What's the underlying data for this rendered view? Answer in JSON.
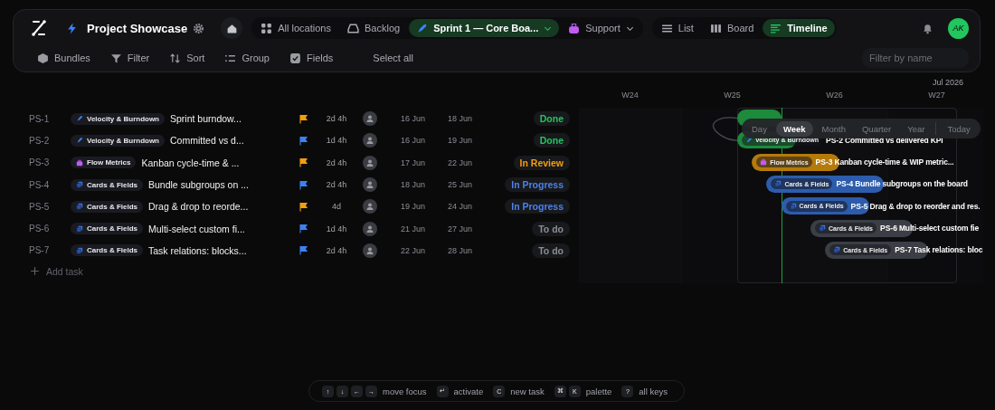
{
  "project": {
    "title": "Project Showcase"
  },
  "nav": [
    {
      "label": "All locations",
      "selected": false,
      "dropdown": false
    },
    {
      "label": "Backlog",
      "selected": false,
      "dropdown": false
    },
    {
      "label": "Sprint 1 — Core Boa...",
      "selected": true,
      "dropdown": true
    },
    {
      "label": "Support",
      "selected": false,
      "dropdown": true
    }
  ],
  "views": [
    {
      "label": "List",
      "selected": false
    },
    {
      "label": "Board",
      "selected": false
    },
    {
      "label": "Timeline",
      "selected": true
    }
  ],
  "user": {
    "initials": "AK"
  },
  "toolbar": [
    "Bundles",
    "Filter",
    "Sort",
    "Group",
    "Fields"
  ],
  "select_all": "Select all",
  "search": {
    "placeholder": "Filter by name"
  },
  "timeline": {
    "month": "Jul 2026",
    "weeks": [
      "W24",
      "W25",
      "W26",
      "W27"
    ],
    "scales": [
      {
        "label": "Day",
        "selected": false
      },
      {
        "label": "Week",
        "selected": true
      },
      {
        "label": "Month",
        "selected": false
      },
      {
        "label": "Quarter",
        "selected": false
      },
      {
        "label": "Year",
        "selected": false
      }
    ],
    "today_button": "Today"
  },
  "tasks": [
    {
      "id": "PS-1",
      "bundle": {
        "label": "Velocity & Burndown",
        "kind": "velocity"
      },
      "title": "Sprint burndow...",
      "flag": {
        "color": "#f59e0b"
      },
      "estimate": "2d 4h",
      "start": "16 Jun",
      "end": "18 Jun",
      "status": {
        "label": "Done",
        "kind": "done"
      }
    },
    {
      "id": "PS-2",
      "bundle": {
        "label": "Velocity & Burndown",
        "kind": "velocity"
      },
      "title": "Committed vs d...",
      "flag": {
        "color": "#3b82f6"
      },
      "estimate": "1d 4h",
      "start": "16 Jun",
      "end": "19 Jun",
      "status": {
        "label": "Done",
        "kind": "done"
      },
      "bar": {
        "bundle": "Velocity & Burndown",
        "id": "PS-2",
        "title": "Committed vs delivered KPI"
      }
    },
    {
      "id": "PS-3",
      "bundle": {
        "label": "Flow Metrics",
        "kind": "flow"
      },
      "title": "Kanban cycle-time & ...",
      "flag": {
        "color": "#f59e0b"
      },
      "estimate": "2d 4h",
      "start": "17 Jun",
      "end": "22 Jun",
      "status": {
        "label": "In Review",
        "kind": "review"
      },
      "bar": {
        "bundle": "Flow Metrics",
        "id": "PS-3",
        "title": "Kanban cycle-time & WIP metric..."
      }
    },
    {
      "id": "PS-4",
      "bundle": {
        "label": "Cards & Fields",
        "kind": "cards"
      },
      "title": "Bundle subgroups on ...",
      "flag": {
        "color": "#3b82f6"
      },
      "estimate": "2d 4h",
      "start": "18 Jun",
      "end": "25 Jun",
      "status": {
        "label": "In Progress",
        "kind": "progress"
      },
      "bar": {
        "bundle": "Cards & Fields",
        "id": "PS-4",
        "title": "Bundle subgroups on the board"
      }
    },
    {
      "id": "PS-5",
      "bundle": {
        "label": "Cards & Fields",
        "kind": "cards"
      },
      "title": "Drag & drop to reorde...",
      "flag": {
        "color": "#f59e0b"
      },
      "estimate": "4d",
      "start": "19 Jun",
      "end": "24 Jun",
      "status": {
        "label": "In Progress",
        "kind": "progress"
      },
      "bar": {
        "bundle": "Cards & Fields",
        "id": "PS-5",
        "title": "Drag & drop to reorder and res."
      }
    },
    {
      "id": "PS-6",
      "bundle": {
        "label": "Cards & Fields",
        "kind": "cards"
      },
      "title": "Multi-select custom fi...",
      "flag": {
        "color": "#3b82f6"
      },
      "estimate": "1d 4h",
      "start": "21 Jun",
      "end": "27 Jun",
      "status": {
        "label": "To do",
        "kind": "todo"
      },
      "bar": {
        "bundle": "Cards & Fields",
        "id": "PS-6",
        "title": "Multi-select custom fie"
      }
    },
    {
      "id": "PS-7",
      "bundle": {
        "label": "Cards & Fields",
        "kind": "cards"
      },
      "title": "Task relations: blocks...",
      "flag": {
        "color": "#3b82f6"
      },
      "estimate": "2d 4h",
      "start": "22 Jun",
      "end": "28 Jun",
      "status": {
        "label": "To do",
        "kind": "todo"
      },
      "bar": {
        "bundle": "Cards & Fields",
        "id": "PS-7",
        "title": "Task relations: bloc"
      }
    }
  ],
  "add_task": "Add task",
  "shortcuts": [
    {
      "keys": [
        "↑",
        "↓",
        "←",
        "→"
      ],
      "label": "move focus"
    },
    {
      "keys": [
        "↵"
      ],
      "label": "activate"
    },
    {
      "keys": [
        "C"
      ],
      "label": "new task"
    },
    {
      "keys": [
        "⌘",
        "K"
      ],
      "label": "palette"
    },
    {
      "keys": [
        "?"
      ],
      "label": "all keys"
    }
  ]
}
